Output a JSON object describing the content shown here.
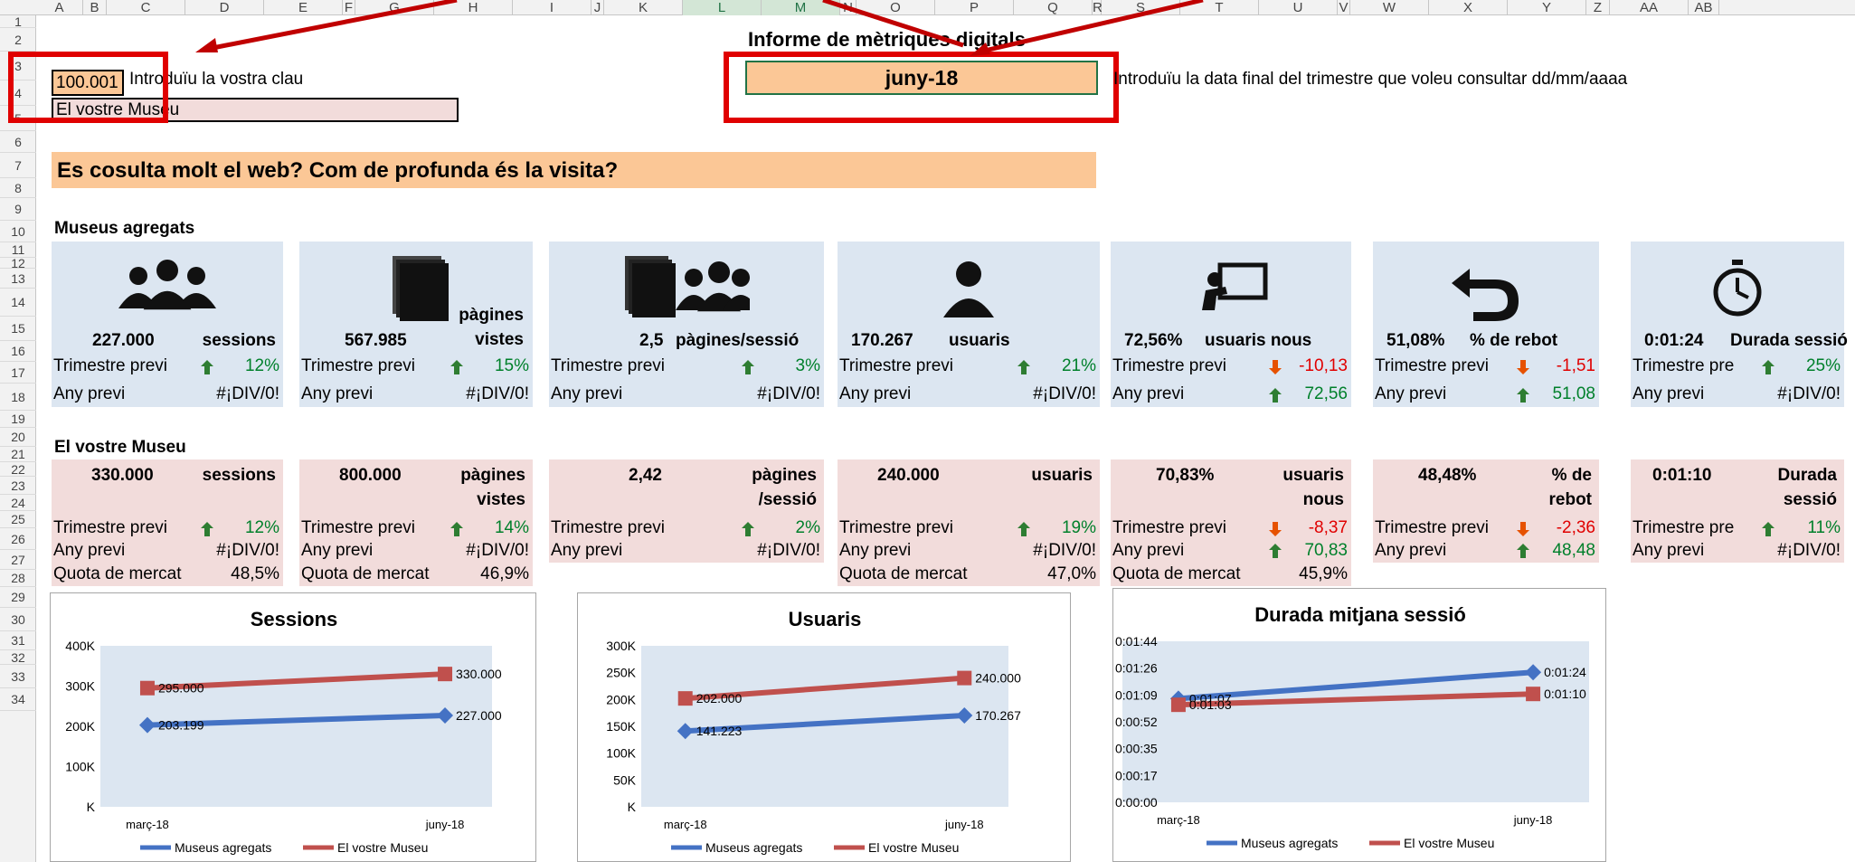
{
  "columns": [
    "A",
    "B",
    "C",
    "D",
    "E",
    "F",
    "G",
    "H",
    "I",
    "J",
    "K",
    "L",
    "M",
    "N",
    "O",
    "P",
    "Q",
    "R",
    "S",
    "T",
    "U",
    "V",
    "W",
    "X",
    "Y",
    "Z",
    "AA",
    "AB"
  ],
  "rows": [
    "1",
    "2",
    "3",
    "4",
    "5",
    "6",
    "7",
    "8",
    "9",
    "10",
    "11",
    "12",
    "13",
    "14",
    "15",
    "16",
    "17",
    "18",
    "19",
    "20",
    "21",
    "22",
    "23",
    "24",
    "25",
    "26",
    "27",
    "28",
    "29",
    "30",
    "31",
    "32",
    "33",
    "34"
  ],
  "header": {
    "key_value": "100.001",
    "key_label": "Introduïu la vostra clau",
    "museum_name": "El vostre Museu",
    "report_title": "Informe de mètriques digitals",
    "date_value": "juny-18",
    "date_label": "Introduïu la data final del trimestre que voleu consultar dd/mm/aaaa"
  },
  "banner": "Es cosulta molt el web? Com de profunda és la visita?",
  "aggregated": {
    "title": "Museus agregats",
    "cards": [
      {
        "value": "227.000",
        "unit": "sessions",
        "prev_label": "Trimestre previ",
        "prev_arrow": "up",
        "prev_value": "12%",
        "year_label": "Any previ",
        "year_arrow": "",
        "year_value": "#¡DIV/0!",
        "icon": "people-group-icon"
      },
      {
        "value": "567.985",
        "unit": "pàgines vistes",
        "prev_label": "Trimestre previ",
        "prev_arrow": "up",
        "prev_value": "15%",
        "year_label": "Any previ",
        "year_arrow": "",
        "year_value": "#¡DIV/0!",
        "icon": "pages-stack-icon"
      },
      {
        "value": "2,5",
        "unit": "pàgines/sessió",
        "prev_label": "Trimestre previ",
        "prev_arrow": "up",
        "prev_value": "3%",
        "year_label": "Any previ",
        "year_arrow": "",
        "year_value": "#¡DIV/0!",
        "icon": "pages-people-icon"
      },
      {
        "value": "170.267",
        "unit": "usuaris",
        "prev_label": "Trimestre previ",
        "prev_arrow": "up",
        "prev_value": "21%",
        "year_label": "Any previ",
        "year_arrow": "",
        "year_value": "#¡DIV/0!",
        "icon": "user-icon"
      },
      {
        "value": "72,56%",
        "unit": "usuaris nous",
        "prev_label": "Trimestre previ",
        "prev_arrow": "down",
        "prev_value": "-10,13",
        "year_label": "Any previ",
        "year_arrow": "up",
        "year_value": "72,56",
        "icon": "presenter-icon"
      },
      {
        "value": "51,08%",
        "unit": "% de rebot",
        "prev_label": "Trimestre previ",
        "prev_arrow": "down",
        "prev_value": "-1,51",
        "year_label": "Any previ",
        "year_arrow": "up",
        "year_value": "51,08",
        "icon": "return-arrow-icon"
      },
      {
        "value": "0:01:24",
        "unit": "Durada sessió",
        "prev_label": "Trimestre pre",
        "prev_arrow": "up",
        "prev_value": "25%",
        "year_label": "Any previ",
        "year_arrow": "",
        "year_value": "#¡DIV/0!",
        "icon": "stopwatch-icon"
      }
    ]
  },
  "museum": {
    "title": "El vostre Museu",
    "cards": [
      {
        "value": "330.000",
        "unit": "sessions",
        "prev_label": "Trimestre previ",
        "prev_arrow": "up",
        "prev_value": "12%",
        "year_label": "Any previ",
        "year_arrow": "",
        "year_value": "#¡DIV/0!",
        "quota_label": "Quota de mercat",
        "quota_value": "48,5%"
      },
      {
        "value": "800.000",
        "unit": "pàgines vistes",
        "prev_label": "Trimestre previ",
        "prev_arrow": "up",
        "prev_value": "14%",
        "year_label": "Any previ",
        "year_arrow": "",
        "year_value": "#¡DIV/0!",
        "quota_label": "Quota de mercat",
        "quota_value": "46,9%"
      },
      {
        "value": "2,42",
        "unit": "pàgines /sessió",
        "prev_label": "Trimestre previ",
        "prev_arrow": "up",
        "prev_value": "2%",
        "year_label": "Any previ",
        "year_arrow": "",
        "year_value": "#¡DIV/0!",
        "quota_label": "",
        "quota_value": ""
      },
      {
        "value": "240.000",
        "unit": "usuaris",
        "prev_label": "Trimestre previ",
        "prev_arrow": "up",
        "prev_value": "19%",
        "year_label": "Any previ",
        "year_arrow": "",
        "year_value": "#¡DIV/0!",
        "quota_label": "Quota de mercat",
        "quota_value": "47,0%"
      },
      {
        "value": "70,83%",
        "unit": "usuaris nous",
        "prev_label": "Trimestre previ",
        "prev_arrow": "down",
        "prev_value": "-8,37",
        "year_label": "Any previ",
        "year_arrow": "up",
        "year_value": "70,83",
        "quota_label": "Quota de mercat",
        "quota_value": "45,9%"
      },
      {
        "value": "48,48%",
        "unit": "% de rebot",
        "prev_label": "Trimestre previ",
        "prev_arrow": "down",
        "prev_value": "-2,36",
        "year_label": "Any previ",
        "year_arrow": "up",
        "year_value": "48,48",
        "quota_label": "",
        "quota_value": ""
      },
      {
        "value": "0:01:10",
        "unit": "Durada sessió",
        "prev_label": "Trimestre pre",
        "prev_arrow": "up",
        "prev_value": "11%",
        "year_label": "Any previ",
        "year_arrow": "",
        "year_value": "#¡DIV/0!",
        "quota_label": "",
        "quota_value": ""
      }
    ]
  },
  "colors": {
    "accent_orange": "#fbc796",
    "callout_red": "#e00000",
    "series_blue": "#4472c4",
    "series_red": "#c0504d",
    "card_blue": "#dce6f1",
    "card_pink": "#f2dcdb",
    "arrow_green": "#2e7d32",
    "arrow_red": "#e65100"
  },
  "chart_data": [
    {
      "type": "line",
      "title": "Sessions",
      "categories": [
        "març-18",
        "juny-18"
      ],
      "yticks": [
        "400K",
        "300K",
        "200K",
        "100K",
        "K"
      ],
      "ylim": [
        0,
        400000
      ],
      "series": [
        {
          "name": "Museus agregats",
          "values": [
            203199,
            227000
          ],
          "labels": [
            "203.199",
            "227.000"
          ]
        },
        {
          "name": "El vostre Museu",
          "values": [
            295000,
            330000
          ],
          "labels": [
            "295.000",
            "330.000"
          ]
        }
      ],
      "legend": "bottom"
    },
    {
      "type": "line",
      "title": "Usuaris",
      "categories": [
        "març-18",
        "juny-18"
      ],
      "yticks": [
        "300K",
        "250K",
        "200K",
        "150K",
        "100K",
        "50K",
        "K"
      ],
      "ylim": [
        0,
        300000
      ],
      "series": [
        {
          "name": "Museus agregats",
          "values": [
            141223,
            170267
          ],
          "labels": [
            "141.223",
            "170.267"
          ]
        },
        {
          "name": "El vostre Museu",
          "values": [
            202000,
            240000
          ],
          "labels": [
            "202.000",
            "240.000"
          ]
        }
      ],
      "legend": "bottom"
    },
    {
      "type": "line",
      "title": "Durada mitjana sessió",
      "categories": [
        "març-18",
        "juny-18"
      ],
      "yticks": [
        "0:01:44",
        "0:01:26",
        "0:01:09",
        "0:00:52",
        "0:00:35",
        "0:00:17",
        "0:00:00"
      ],
      "ylim": [
        0,
        104
      ],
      "series": [
        {
          "name": "Museus agregats",
          "values": [
            67,
            84
          ],
          "labels": [
            "0:01:07",
            "0:01:24"
          ]
        },
        {
          "name": "El vostre Museu",
          "values": [
            63,
            70
          ],
          "labels": [
            "0:01:03",
            "0:01:10"
          ]
        }
      ],
      "legend": "bottom"
    }
  ]
}
